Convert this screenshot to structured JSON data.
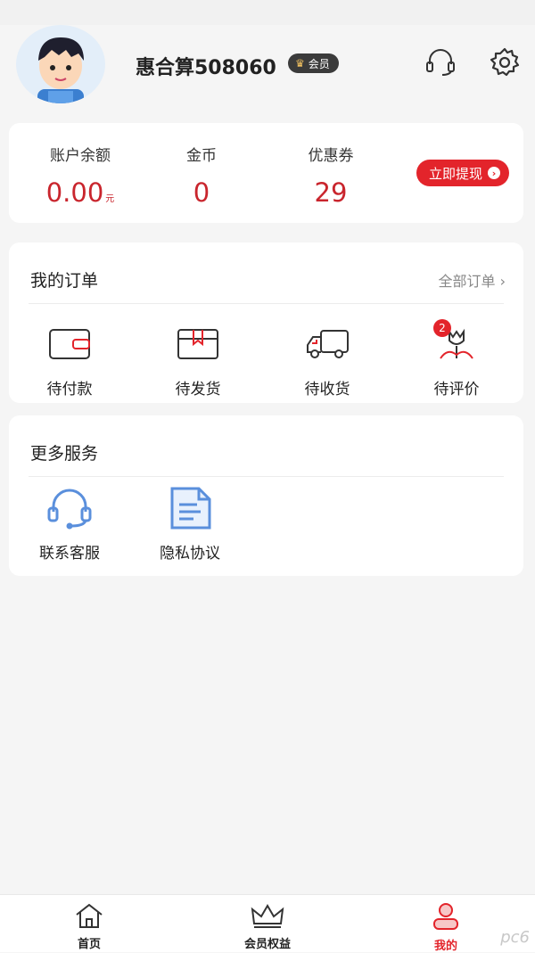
{
  "header": {
    "username": "惠合算508060",
    "badge_label": "会员",
    "icons": {
      "support": "headset-icon",
      "settings": "gear-icon"
    }
  },
  "stats": {
    "items": [
      {
        "label": "账户余额",
        "value": "0.00",
        "unit": "元"
      },
      {
        "label": "金币",
        "value": "0",
        "unit": ""
      },
      {
        "label": "优惠券",
        "value": "29",
        "unit": ""
      }
    ],
    "withdraw_label": "立即提现"
  },
  "orders": {
    "title": "我的订单",
    "all_link": "全部订单",
    "items": [
      {
        "label": "待付款",
        "icon": "wallet-icon"
      },
      {
        "label": "待发货",
        "icon": "box-icon"
      },
      {
        "label": "待收货",
        "icon": "truck-icon"
      },
      {
        "label": "待评价",
        "icon": "flower-icon",
        "badge": "2"
      }
    ]
  },
  "services": {
    "title": "更多服务",
    "items": [
      {
        "label": "联系客服",
        "icon": "headset-icon"
      },
      {
        "label": "隐私协议",
        "icon": "document-icon"
      }
    ]
  },
  "tabbar": {
    "items": [
      {
        "label": "首页",
        "icon": "home-icon"
      },
      {
        "label": "会员权益",
        "icon": "crown-icon"
      },
      {
        "label": "我的",
        "icon": "user-icon",
        "active": true
      }
    ]
  },
  "watermark": "pc6",
  "colors": {
    "accent": "#e3242b",
    "value_red": "#c9252d",
    "background": "#f5f5f5"
  }
}
